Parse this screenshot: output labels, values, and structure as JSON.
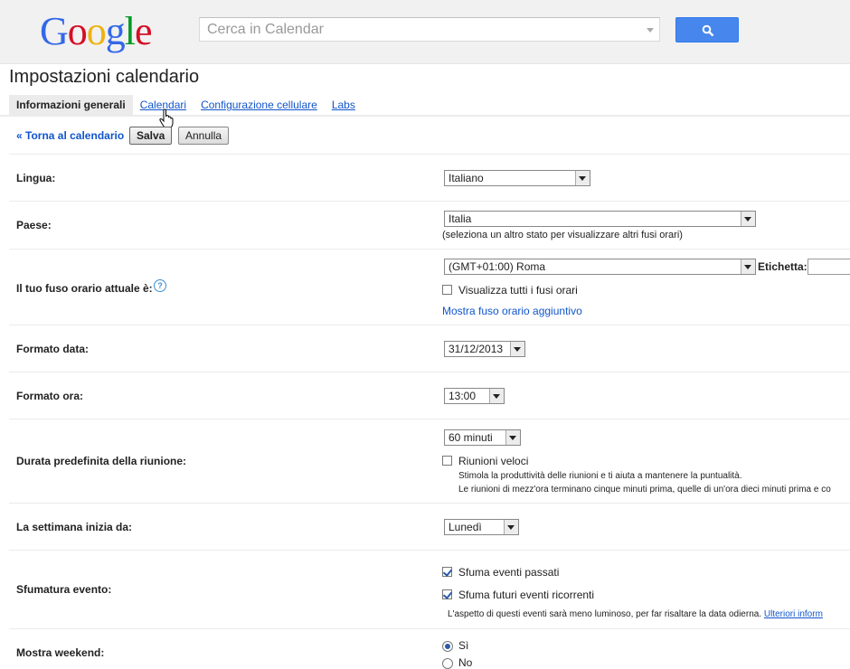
{
  "header": {
    "logo_letters": [
      {
        "ch": "G",
        "color": "#3369e8"
      },
      {
        "ch": "o",
        "color": "#d50f25"
      },
      {
        "ch": "o",
        "color": "#eeb211"
      },
      {
        "ch": "g",
        "color": "#3369e8"
      },
      {
        "ch": "l",
        "color": "#009925"
      },
      {
        "ch": "e",
        "color": "#d50f25"
      }
    ],
    "search_placeholder": "Cerca in Calendar",
    "search_button_icon": "search-icon"
  },
  "page": {
    "title": "Impostazioni calendario",
    "tabs": [
      {
        "label": "Informazioni generali",
        "active": true
      },
      {
        "label": "Calendari",
        "active": false
      },
      {
        "label": "Configurazione cellulare",
        "active": false
      },
      {
        "label": "Labs",
        "active": false
      }
    ],
    "back_link": "« Torna al calendario",
    "save_label": "Salva",
    "cancel_label": "Annulla"
  },
  "settings": {
    "language": {
      "label": "Lingua:",
      "value": "Italiano"
    },
    "country": {
      "label": "Paese:",
      "value": "Italia",
      "hint": "(seleziona un altro stato per visualizzare altri fusi orari)"
    },
    "timezone": {
      "label": "Il tuo fuso orario attuale è:",
      "value": "(GMT+01:00) Roma",
      "tag_label": "Etichetta:",
      "show_all_label": "Visualizza tutti i fusi orari",
      "show_all_checked": false,
      "extra_link": "Mostra fuso orario aggiuntivo"
    },
    "date_format": {
      "label": "Formato data:",
      "value": "31/12/2013"
    },
    "time_format": {
      "label": "Formato ora:",
      "value": "13:00"
    },
    "meeting_duration": {
      "label": "Durata predefinita della riunione:",
      "value": "60 minuti",
      "speedy_label": "Riunioni veloci",
      "speedy_checked": false,
      "speedy_desc_1": "Stimola la produttività delle riunioni e ti aiuta a mantenere la puntualità.",
      "speedy_desc_2": "Le riunioni di mezz'ora terminano cinque minuti prima, quelle di un'ora dieci minuti prima e co"
    },
    "week_start": {
      "label": "La settimana inizia da:",
      "value": "Lunedì"
    },
    "event_dimming": {
      "label": "Sfumatura evento:",
      "past_label": "Sfuma eventi passati",
      "past_checked": true,
      "future_label": "Sfuma futuri eventi ricorrenti",
      "future_checked": true,
      "note": "L'aspetto di questi eventi sarà meno luminoso, per far risaltare la data odierna.",
      "note_link": "Ulteriori inform"
    },
    "weekend": {
      "label": "Mostra weekend:",
      "yes_label": "Sì",
      "no_label": "No",
      "selected": "Sì"
    }
  }
}
